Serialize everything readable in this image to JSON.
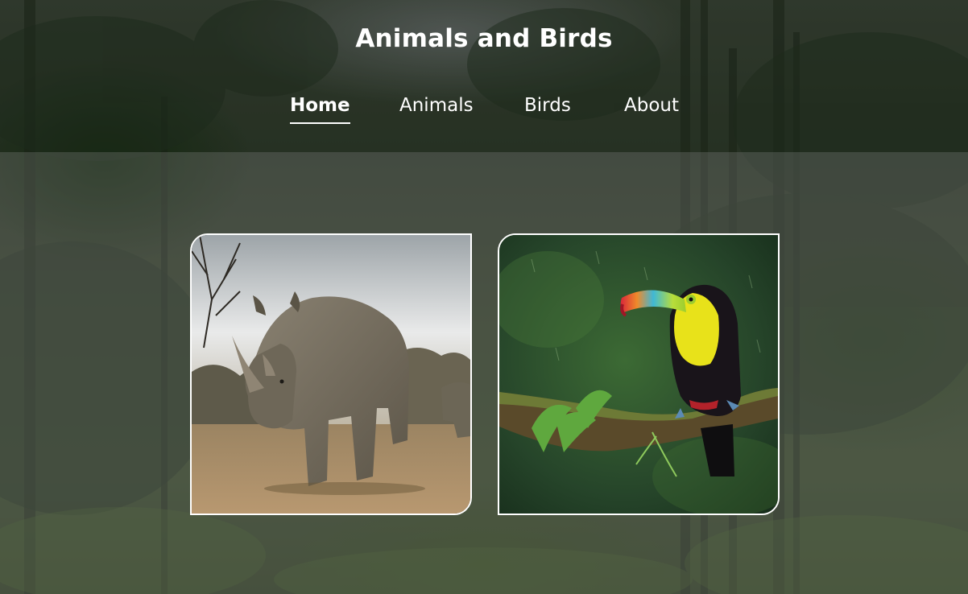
{
  "site": {
    "title": "Animals and Birds"
  },
  "nav": {
    "items": [
      {
        "label": "Home",
        "active": true
      },
      {
        "label": "Animals",
        "active": false
      },
      {
        "label": "Birds",
        "active": false
      },
      {
        "label": "About",
        "active": false
      }
    ]
  },
  "cards": [
    {
      "subject": "rhinoceros",
      "icon": "rhino-photo"
    },
    {
      "subject": "toucan",
      "icon": "toucan-photo"
    }
  ],
  "colors": {
    "text": "#ffffff",
    "card_border": "#ffffff"
  }
}
